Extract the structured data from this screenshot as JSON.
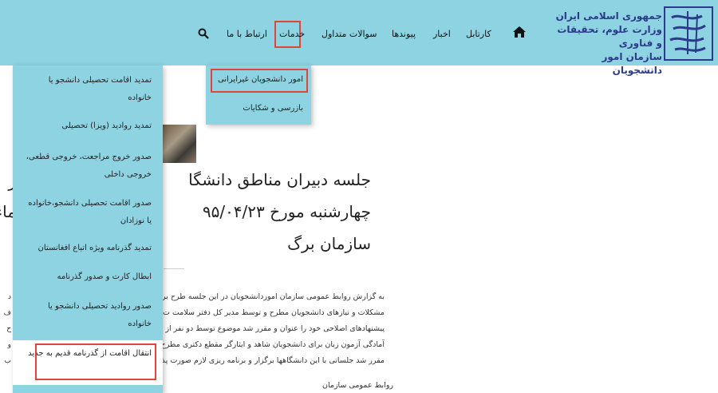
{
  "header": {
    "logo_line1": "جمهوری اسلامی ایران",
    "logo_line2": "وزارت علوم، تحقیقات و فناوری",
    "logo_line3": "سازمان امور دانشجویان",
    "logo_mark": "سازمان امور دانشجویان",
    "nav": {
      "home_icon": "home-icon",
      "kartabl": "کارتابل",
      "news": "اخبار",
      "links": "پیوندها",
      "faq": "سوالات متداول",
      "services": "خدمات",
      "contact": "ارتباط با ما",
      "search_icon": "search-icon"
    }
  },
  "services_menu": [
    "امور دانشجویان غیرایرانی",
    "بازرسی و شکایات"
  ],
  "left_menu": [
    "تمدید اقامت تحصیلی دانشجو یا خانواده",
    "تمدید روادید (ویزا) تحصیلی",
    "صدور خروج مراجعت، خروجی قطعی، خروجی داخلی",
    "صدور اقامت تحصیلی دانشجو،خانواده یا نوزادان",
    "تمدید گذرنامه ویژه اتباع افغانستان",
    "ابطال کارت و صدور گذرنامه",
    "صدور روادید تحصیلی دانشجو یا خانواده",
    "انتقال اقامت از گذرنامه قدیم به جدید"
  ],
  "article": {
    "headline_line1": "جلسه دبیران مناطق دانشگا",
    "headline_line2": "چهارشنبه مورخ ۹۵/۰۴/۲۳",
    "headline_line3": "سازمان برگ",
    "left_fragment_1": "ر",
    "left_fragment_2": "ماء",
    "body_lines": [
      "به گزارش روابط عمومی سازمان اموردانشجویان در این جلسه طرح بررس",
      "مشکلات و نیازهای دانشجویان مطرح و توسط مدیر کل دفتر سلامت ت",
      "پیشنهادهای اصلاحی خود را عنوان و مقرر شد موضوع توسط دو نفر از",
      "آمادگی آزمون زبان برای دانشجویان شاهد و ایثارگر مقطع دکتری مطرح",
      "مقرر شد جلساتی با این دانشگاهها برگزار و برنامه ریزی لازم صورت پذی"
    ],
    "left_body_fragments": [
      "د",
      "ف",
      "ح",
      "و",
      "ب"
    ],
    "author": "روابط عمومی سازمان"
  },
  "colors": {
    "header_bg": "#8dd3e2",
    "logo_blue": "#2b3a8a",
    "highlight_red": "#e0443a"
  }
}
